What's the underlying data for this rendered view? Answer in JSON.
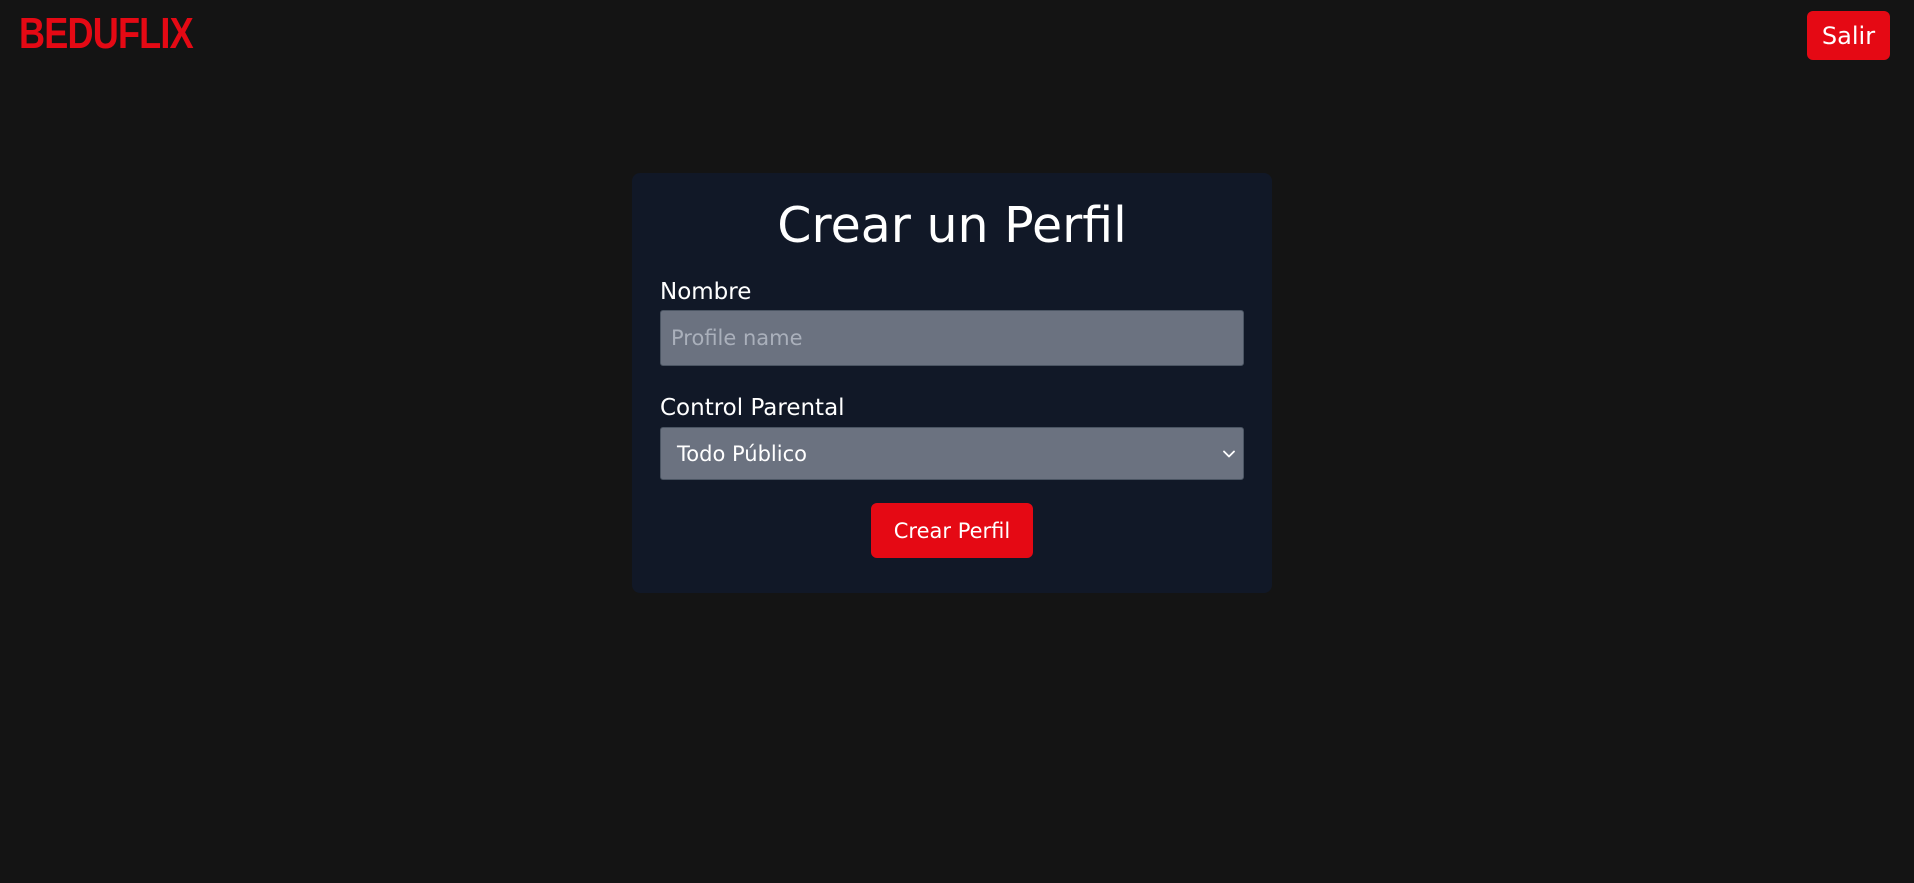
{
  "header": {
    "logo_text": "BEDUFLIX",
    "logout_label": "Salir"
  },
  "form": {
    "title": "Crear un Perfil",
    "name_label": "Nombre",
    "name_placeholder": "Profile name",
    "name_value": "",
    "parental_label": "Control Parental",
    "parental_selected": "Todo Público",
    "submit_label": "Crear Perfil"
  },
  "icons": {
    "select_chevron": "chevron-down-icon"
  },
  "colors": {
    "background": "#141414",
    "card": "#111827",
    "brand_red": "#e50914",
    "input_bg": "#6b7280"
  }
}
